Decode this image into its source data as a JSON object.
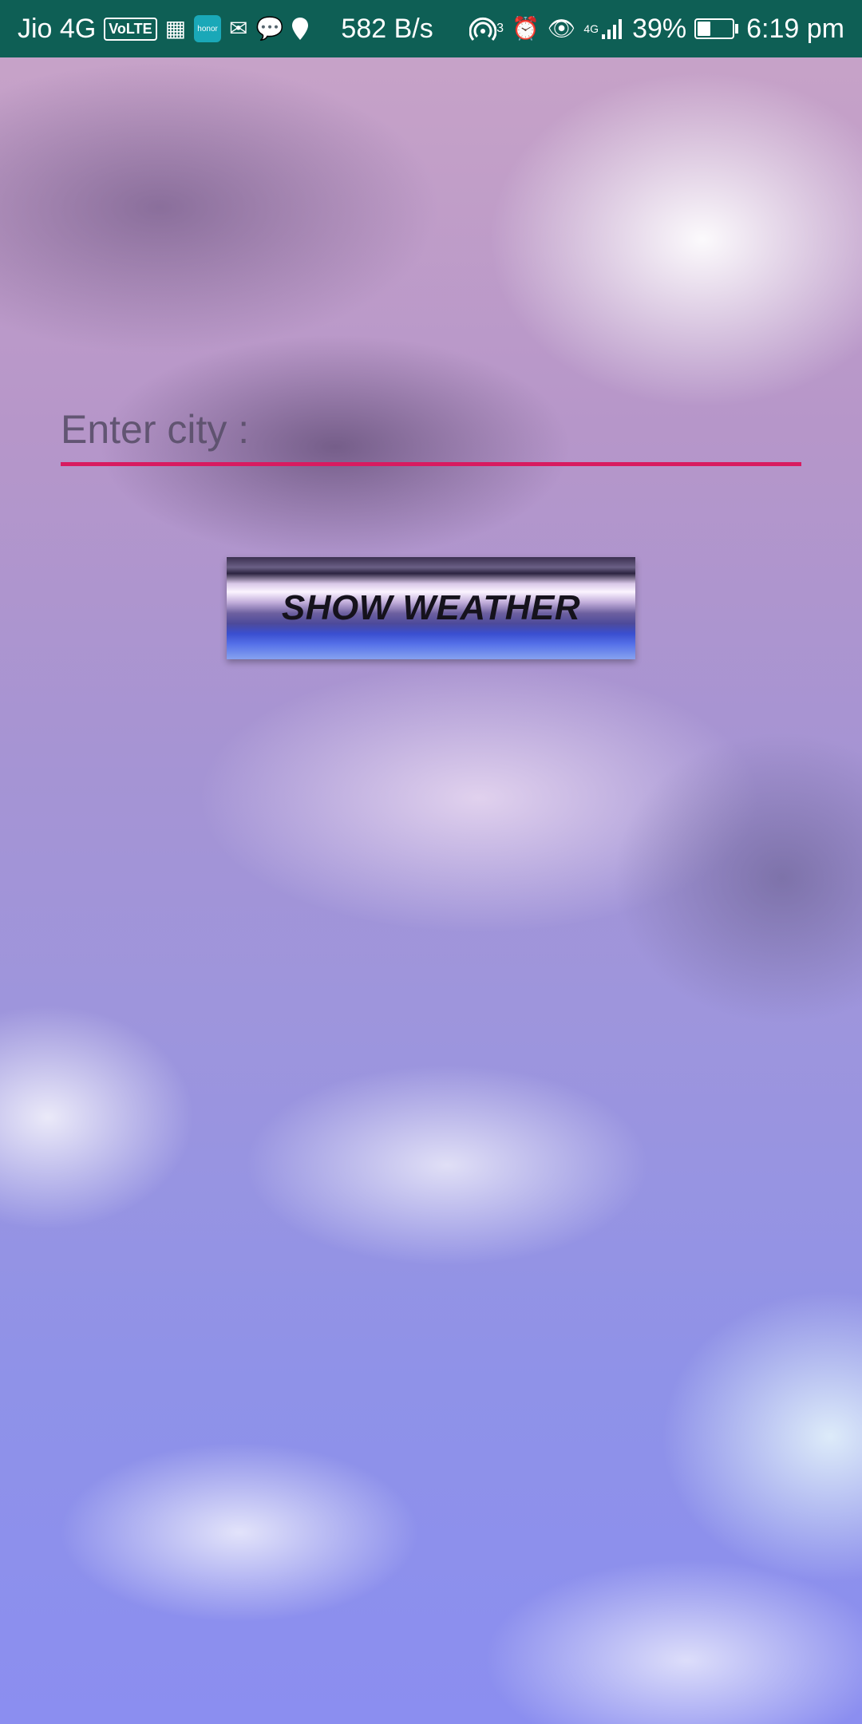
{
  "status_bar": {
    "carrier": "Jio 4G",
    "volte": "VoLTE",
    "honor_label": "honor",
    "net_speed": "582 B/s",
    "hotspot_count": "3",
    "signal_type": "4G",
    "battery_percent": "39%",
    "battery_level": 0.39,
    "time": "6:19 pm",
    "icons": [
      "calendar-icon",
      "honor-app-icon",
      "mail-icon",
      "chat-icon",
      "location-icon",
      "hotspot-icon",
      "alarm-icon",
      "eye-icon",
      "signal-icon",
      "battery-icon"
    ]
  },
  "form": {
    "city_placeholder": "Enter city :",
    "city_value": "",
    "show_weather_label": "SHOW WEATHER"
  },
  "colors": {
    "status_bar_bg": "#0e5f55",
    "input_underline": "#d81b60"
  }
}
